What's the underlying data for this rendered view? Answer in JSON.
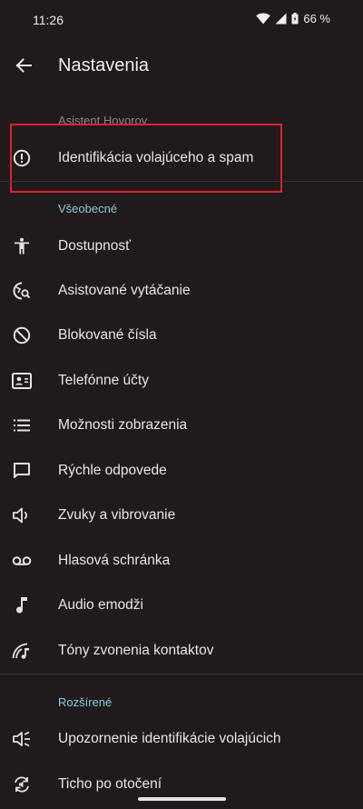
{
  "status": {
    "time": "11:26",
    "battery": "66 %"
  },
  "header": {
    "title": "Nastavenia"
  },
  "sections": {
    "assistant": "Asistent Hovorov",
    "general": "Všeobecné",
    "advanced": "Rozšírené"
  },
  "items": [
    {
      "label": "Identifikácia volajúceho a spam",
      "icon": "alert-circle-icon"
    },
    {
      "label": "Dostupnosť",
      "icon": "accessibility-icon"
    },
    {
      "label": "Asistované vytáčanie",
      "icon": "assisted-dialing-icon"
    },
    {
      "label": "Blokované čísla",
      "icon": "block-icon"
    },
    {
      "label": "Telefónne účty",
      "icon": "contact-card-icon"
    },
    {
      "label": "Možnosti zobrazenia",
      "icon": "list-icon"
    },
    {
      "label": "Rýchle odpovede",
      "icon": "message-icon"
    },
    {
      "label": "Zvuky a vibrovanie",
      "icon": "volume-icon"
    },
    {
      "label": "Hlasová schránka",
      "icon": "voicemail-icon"
    },
    {
      "label": "Audio emodži",
      "icon": "music-note-icon"
    },
    {
      "label": "Tóny zvonenia kontaktov",
      "icon": "ringtone-icon"
    },
    {
      "label": "Upozornenie identifikácie volajúcich",
      "icon": "announce-icon"
    },
    {
      "label": "Ticho po otočení",
      "icon": "flip-silence-icon"
    }
  ],
  "colors": {
    "background": "#1f1a1b",
    "accent": "#8fc6dd",
    "highlight": "#e0202c"
  }
}
